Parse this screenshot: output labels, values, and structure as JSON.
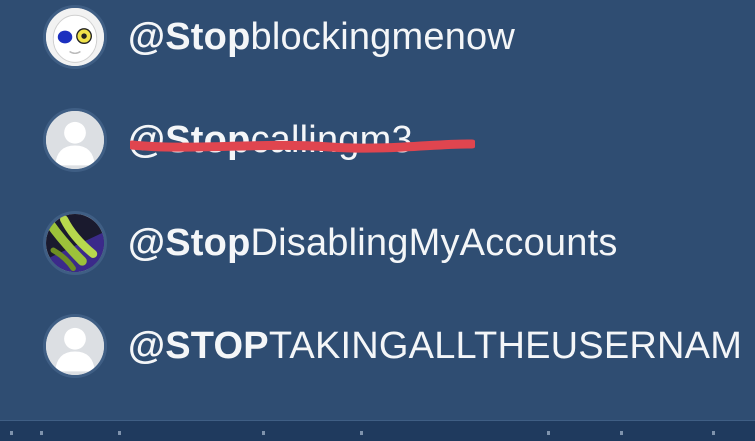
{
  "users": [
    {
      "prefix": "@Stop",
      "rest": "blockingmenow",
      "avatar": "cartoon-avatar"
    },
    {
      "prefix": "@Stop",
      "rest": "callingm3",
      "avatar": "default-avatar",
      "struck_out": true,
      "strike_color": "#e0454f"
    },
    {
      "prefix": "@Stop",
      "rest": "DisablingMyAccounts",
      "avatar": "photo-avatar"
    },
    {
      "prefix": "@STOP",
      "rest": "TAKINGALLTHEUSERNAM",
      "avatar": "default-avatar"
    }
  ],
  "colors": {
    "background": "#2f4d72",
    "text": "#f4f6f8",
    "avatar_default": "#dcdfe3"
  }
}
